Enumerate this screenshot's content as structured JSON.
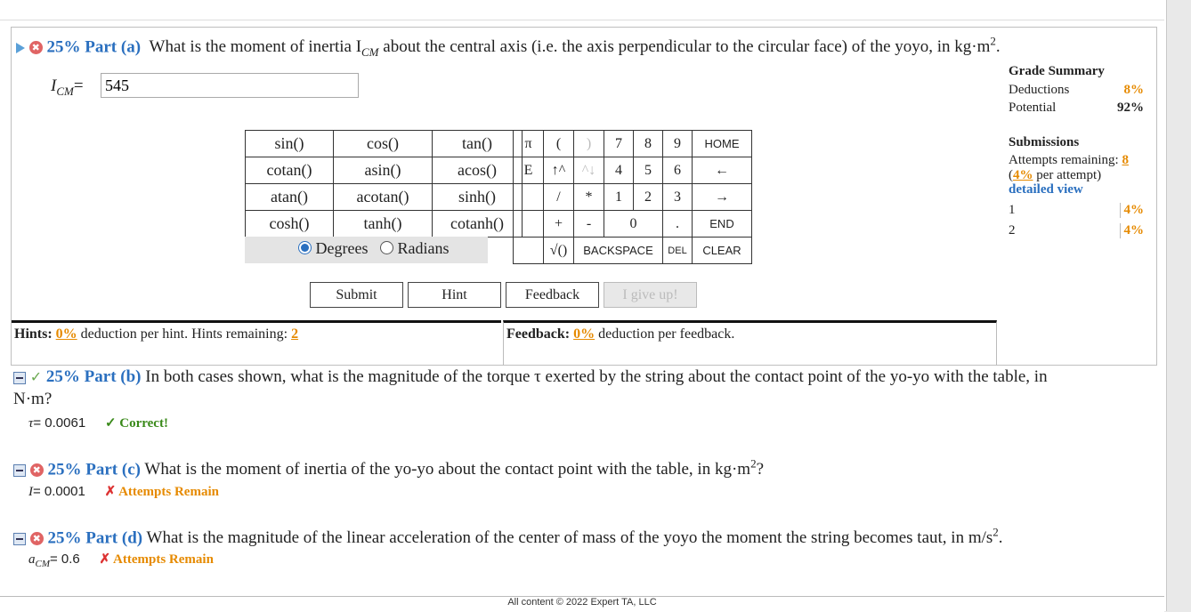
{
  "part_a": {
    "percent": "25%",
    "label": "Part (a)",
    "question": "What is the moment of inertia I",
    "question_sub": "CM",
    "question_rest": " about the central axis (i.e. the axis perpendicular to the circular face) of the yoyo, in kg·m",
    "question_sup": "2",
    "question_end": ".",
    "input_label": "I",
    "input_label_sub": "CM",
    "input_eq": "=",
    "input_value": "545"
  },
  "functions": [
    [
      "sin()",
      "cos()",
      "tan()"
    ],
    [
      "cotan()",
      "asin()",
      "acos()"
    ],
    [
      "atan()",
      "acotan()",
      "sinh()"
    ],
    [
      "cosh()",
      "tanh()",
      "cotanh()"
    ]
  ],
  "keypad": {
    "row1": [
      "π",
      "(",
      ")",
      "7",
      "8",
      "9",
      "HOME"
    ],
    "row2": [
      "E",
      "↑^",
      "^↓",
      "4",
      "5",
      "6",
      "←"
    ],
    "row3": [
      "",
      "/",
      "*",
      "1",
      "2",
      "3",
      "→"
    ],
    "row4": [
      "",
      "+",
      "-",
      "0",
      ".",
      "END"
    ],
    "row5": [
      "",
      "√()",
      "BACKSPACE",
      "DEL",
      "CLEAR"
    ]
  },
  "angle_mode": {
    "degrees": "Degrees",
    "radians": "Radians",
    "selected": "Degrees"
  },
  "buttons": {
    "submit": "Submit",
    "hint": "Hint",
    "feedback": "Feedback",
    "give_up": "I give up!"
  },
  "hints": {
    "label": "Hints:",
    "pct": "0%",
    "text": "deduction per hint. Hints remaining:",
    "remaining": "2"
  },
  "feedback": {
    "label": "Feedback:",
    "pct": "0%",
    "text": "deduction per feedback."
  },
  "grade_summary": {
    "title": "Grade Summary",
    "deductions_label": "Deductions",
    "deductions_value": "8%",
    "potential_label": "Potential",
    "potential_value": "92%"
  },
  "submissions": {
    "title": "Submissions",
    "attempts_label": "Attempts remaining:",
    "attempts_value": "8",
    "per_attempt_open": "(",
    "per_attempt_pct": "4%",
    "per_attempt_text": "per attempt)",
    "detailed": "detailed view",
    "rows": [
      {
        "n": "1",
        "pct": "4%"
      },
      {
        "n": "2",
        "pct": "4%"
      }
    ]
  },
  "part_b": {
    "percent": "25%",
    "label": "Part (b)",
    "question": "In both cases shown, what is the magnitude of the torque τ exerted by the string about the contact point of the yo-yo with the table, in",
    "question_line2": "N·m?",
    "answer_label": "τ",
    "answer_value": "= 0.0061",
    "status": "Correct!"
  },
  "part_c": {
    "percent": "25%",
    "label": "Part (c)",
    "question": "What is the moment of inertia of the yo-yo about the contact point with the table, in kg·m",
    "question_sup": "2",
    "question_end": "?",
    "answer_label": "I",
    "answer_value": "= 0.0001",
    "status": "Attempts Remain"
  },
  "part_d": {
    "percent": "25%",
    "label": "Part (d)",
    "question": "What is the magnitude of the linear acceleration of the center of mass of the yoyo the moment the string becomes taut, in m/s",
    "question_sup": "2",
    "question_end": ".",
    "answer_label": "a",
    "answer_label_sub": "CM",
    "answer_value": "= 0.6",
    "status": "Attempts Remain"
  },
  "footer": "All content © 2022 Expert TA, LLC"
}
